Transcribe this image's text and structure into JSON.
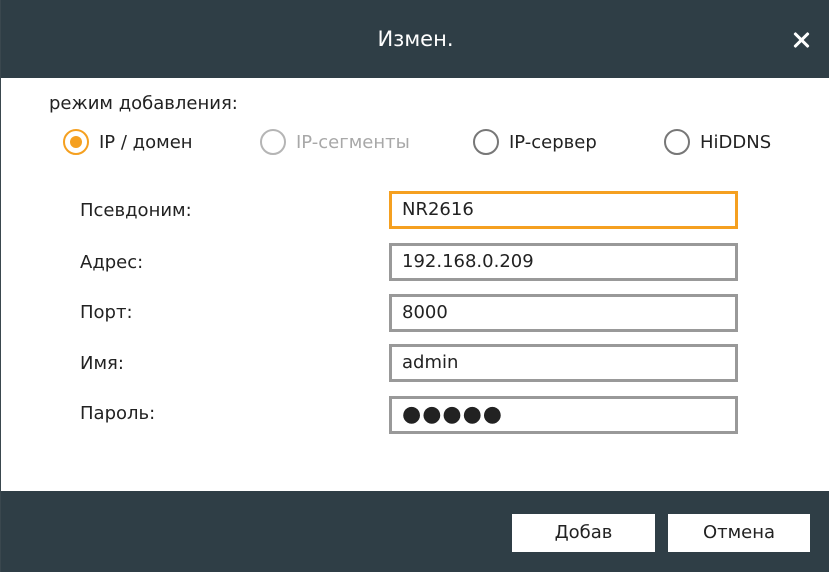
{
  "dialog": {
    "title": "Измен.",
    "close_glyph": "✕"
  },
  "mode": {
    "label": "режим добавления:",
    "options": [
      {
        "label": "IP / домен",
        "checked": true,
        "enabled": true
      },
      {
        "label": "IP-сегменты",
        "checked": false,
        "enabled": false
      },
      {
        "label": "IP-сервер",
        "checked": false,
        "enabled": true
      },
      {
        "label": "HiDDNS",
        "checked": false,
        "enabled": true
      }
    ]
  },
  "form": {
    "alias": {
      "label": "Псевдоним:",
      "value": "NR2616"
    },
    "address": {
      "label": "Адрес:",
      "value": "192.168.0.209"
    },
    "port": {
      "label": "Порт:",
      "value": "8000"
    },
    "username": {
      "label": "Имя:",
      "value": "admin"
    },
    "password": {
      "label": "Пароль:",
      "value": "●●●●●"
    }
  },
  "buttons": {
    "add": "Добав",
    "cancel": "Отмена"
  },
  "colors": {
    "titlebar": "#2f3e46",
    "accent": "#f5a020",
    "field_border": "#999999",
    "disabled_text": "#a8a8a8"
  }
}
